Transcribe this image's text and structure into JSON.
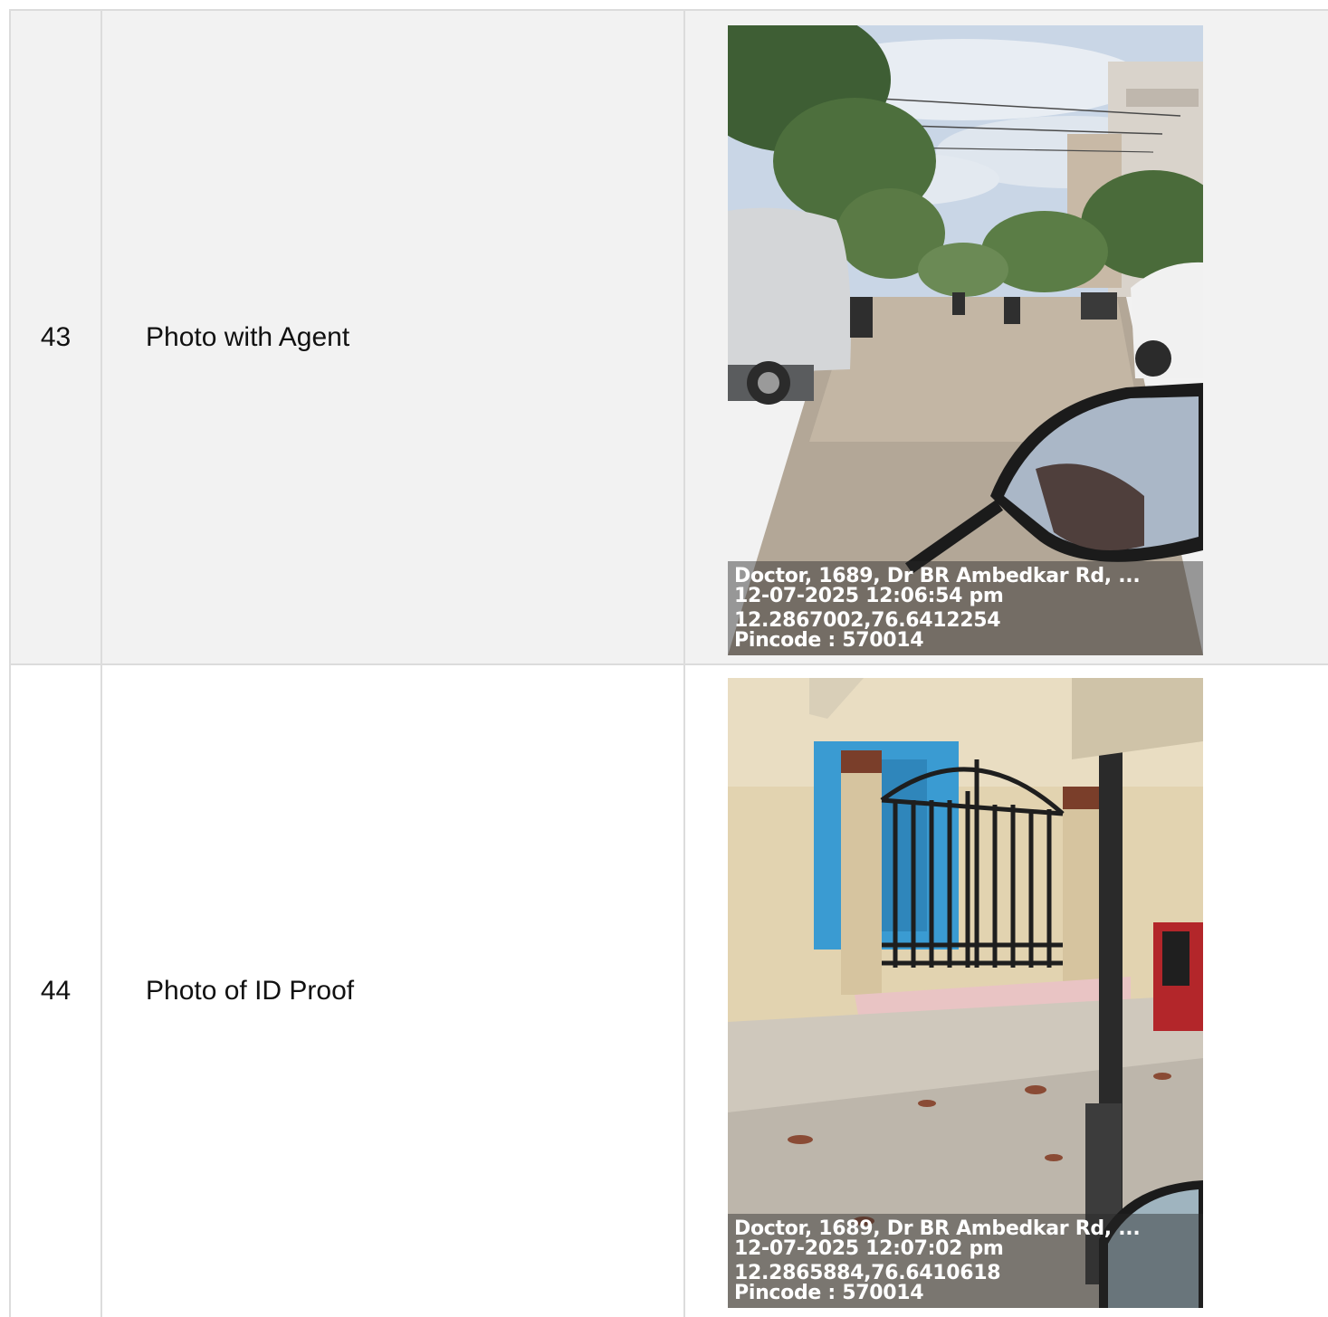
{
  "rows": [
    {
      "number": "43",
      "label": "Photo with Agent",
      "photo_caption": {
        "address": "Doctor, 1689, Dr BR Ambedkar Rd, ...",
        "datetime": "12-07-2025 12:06:54 pm",
        "coordinates": "12.2867002,76.6412254",
        "pincode": "Pincode : 570014"
      }
    },
    {
      "number": "44",
      "label": "Photo of ID Proof",
      "photo_caption": {
        "address": "Doctor, 1689, Dr BR Ambedkar Rd, ...",
        "datetime": "12-07-2025 12:07:02 pm",
        "coordinates": "12.2865884,76.6410618",
        "pincode": "Pincode : 570014"
      }
    }
  ]
}
